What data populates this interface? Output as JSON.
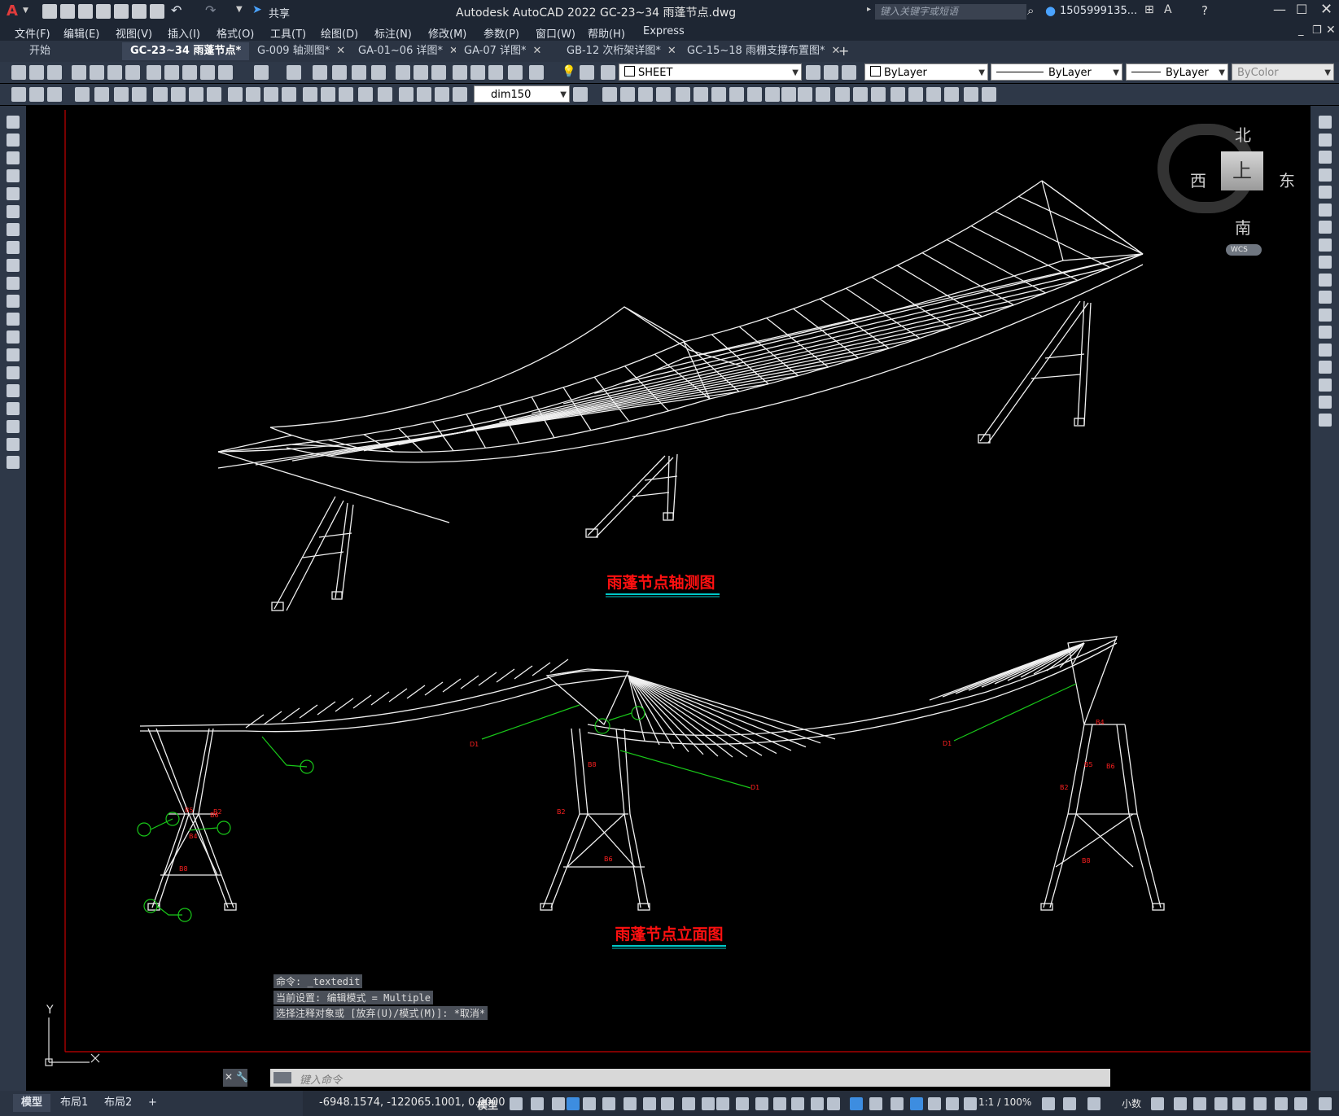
{
  "titlebar": {
    "app_title": "Autodesk AutoCAD 2022    GC-23~34 雨蓬节点.dwg",
    "share": "共享",
    "search_placeholder": "键入关键字或短语",
    "user": "1505999135...",
    "logo": "A"
  },
  "menus": [
    "文件(F)",
    "编辑(E)",
    "视图(V)",
    "插入(I)",
    "格式(O)",
    "工具(T)",
    "绘图(D)",
    "标注(N)",
    "修改(M)",
    "参数(P)",
    "窗口(W)",
    "帮助(H)",
    "Express"
  ],
  "tabs": {
    "start": "开始",
    "items": [
      "GC-23~34 雨蓬节点*",
      "G-009 轴测图*",
      "GA-01~06 详图*",
      "GA-07 详图*",
      "GB-12 次桁架详图*",
      "GC-15~18 雨棚支撑布置图*"
    ],
    "add": "+"
  },
  "properties": {
    "layer": "SHEET",
    "color": "ByLayer",
    "linetype": "ByLayer",
    "lineweight": "ByLayer",
    "plotstyle": "ByColor",
    "dimstyle": "dim150"
  },
  "viewcube": {
    "north": "北",
    "south": "南",
    "east": "东",
    "west": "西",
    "top": "上",
    "wcs": "WCS"
  },
  "drawing": {
    "title_axo": "雨蓬节点轴测图",
    "title_elev": "雨蓬节点立面图",
    "labels": [
      "B2",
      "B4",
      "B5",
      "B6",
      "B8",
      "D1",
      "B2",
      "B8",
      "B6",
      "D1",
      "B2",
      "B4",
      "B5",
      "B6",
      "B8",
      "D1"
    ],
    "ucs_y": "Y",
    "colors": {
      "structure": "#f0f0f0",
      "title": "#ff1010",
      "underline": "#00c8c8",
      "note_label": "#ff2020",
      "leader": "#19c819",
      "border": "#c80000"
    }
  },
  "command": {
    "history": [
      "命令: _textedit",
      "当前设置: 编辑模式 = Multiple",
      "选择注释对象或 [放弃(U)/模式(M)]: *取消*"
    ],
    "input_placeholder": "键入命令"
  },
  "status": {
    "tabs": [
      "模型",
      "布局1",
      "布局2"
    ],
    "add_tab": "+",
    "coords": "-6948.1574, -122065.1001, 0.0000",
    "model": "模型",
    "scale": "1:1 / 100%",
    "units": "小数"
  }
}
